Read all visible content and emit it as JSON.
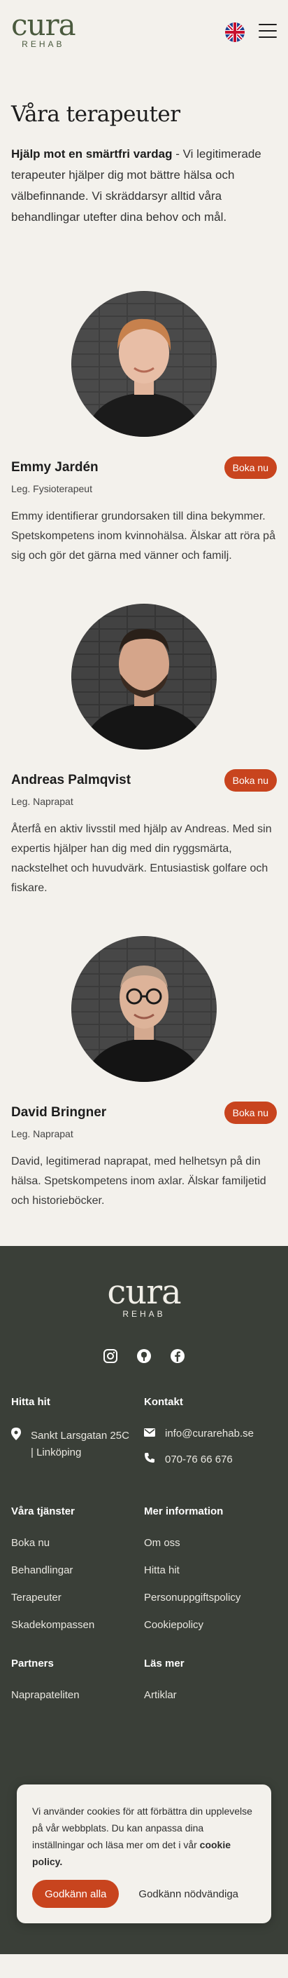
{
  "header": {
    "logo_word": "cura",
    "logo_sub": "REHAB",
    "language_icon": "uk-flag-icon",
    "menu_icon": "hamburger-icon"
  },
  "intro": {
    "title": "Våra terapeuter",
    "lead_bold": "Hjälp mot en smärtfri vardag",
    "lead_rest": " - Vi legitimerade terapeuter hjälper dig mot bättre hälsa och välbefinnande. Vi skräddarsyr alltid våra behandlingar utefter dina behov och mål."
  },
  "therapists": [
    {
      "name": "Emmy Jardén",
      "title": "Leg. Fysioterapeut",
      "button": "Boka nu",
      "description": "Emmy identifierar grundorsaken till dina bekymmer. Spetskompetens inom kvinnohälsa. Älskar att röra på sig och gör det gärna med vänner och familj."
    },
    {
      "name": "Andreas Palmqvist",
      "title": "Leg. Naprapat",
      "button": "Boka nu",
      "description": "Återfå en aktiv livsstil med hjälp av Andreas. Med sin expertis hjälper han dig med din ryggsmärta, nackstelhet och huvudvärk. Entusiastisk golfare och fiskare."
    },
    {
      "name": "David Bringner",
      "title": "Leg. Naprapat",
      "button": "Boka nu",
      "description": "David, legitimerad naprapat, med helhetsyn på din hälsa. Spetskompetens inom axlar. Älskar familjetid och historieböcker."
    }
  ],
  "footer": {
    "logo_word": "cura",
    "logo_sub": "REHAB",
    "socials": [
      "instagram-icon",
      "github-icon",
      "facebook-icon"
    ],
    "find_us": {
      "heading": "Hitta hit",
      "address_line1": "Sankt Larsgatan 25C",
      "address_line2": "| Linköping"
    },
    "contact": {
      "heading": "Kontakt",
      "email": "info@curarehab.se",
      "phone": "070-76 66 676"
    },
    "services": {
      "heading": "Våra tjänster",
      "links": [
        "Boka nu",
        "Behandlingar",
        "Terapeuter",
        "Skadekompassen"
      ]
    },
    "more_info": {
      "heading": "Mer information",
      "links": [
        "Om oss",
        "Hitta hit",
        "Personuppgiftspolicy",
        "Cookiepolicy"
      ]
    },
    "partners": {
      "heading": "Partners",
      "links": [
        "Naprapateliten"
      ]
    },
    "read_more": {
      "heading": "Läs mer",
      "links": [
        "Artiklar"
      ]
    }
  },
  "cookie": {
    "text": "Vi använder cookies för att förbättra din upplevelse på vår webbplats. Du kan anpassa dina inställningar och läsa mer om det i vår ",
    "link": "cookie policy.",
    "accept": "Godkänn alla",
    "necessary": "Godkänn nödvändiga"
  },
  "colors": {
    "accent": "#c8441e",
    "footer_bg": "#3a3f38",
    "page_bg": "#f3f1ec",
    "brand_green": "#4a5a3e"
  }
}
